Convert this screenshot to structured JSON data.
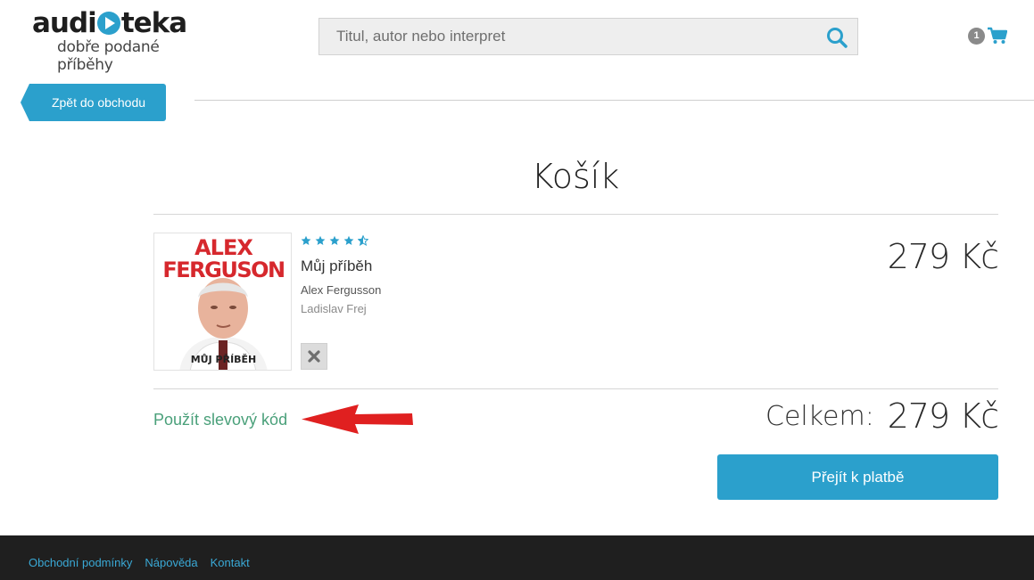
{
  "header": {
    "logo_main_left": "audi",
    "logo_main_right": "teka",
    "logo_sub": "dobře podané příběhy",
    "search_placeholder": "Titul, autor nebo interpret",
    "cart_count": "1"
  },
  "nav": {
    "back_label": "Zpět do obchodu"
  },
  "page": {
    "title": "Košík"
  },
  "item": {
    "cover_title_line1": "ALEX",
    "cover_title_line2": "FERGUSON",
    "cover_subtitle": "MŮJ PŘÍBĚH",
    "rating": 4.5,
    "title": "Můj příběh",
    "author": "Alex Fergusson",
    "narrator": "Ladislav Frej",
    "price": "279 Kč"
  },
  "totals": {
    "discount_link": "Použít slevový kód",
    "total_label": "Celkem:",
    "total_value": "279 Kč",
    "checkout_label": "Přejít k platbě"
  },
  "footer": {
    "links": [
      "Obchodní podmínky",
      "Nápověda",
      "Kontakt"
    ]
  },
  "colors": {
    "accent": "#2ba0cc",
    "link_green": "#4aa07a",
    "annotation_arrow": "#e02020",
    "footer_bg": "#1f1f1f"
  }
}
